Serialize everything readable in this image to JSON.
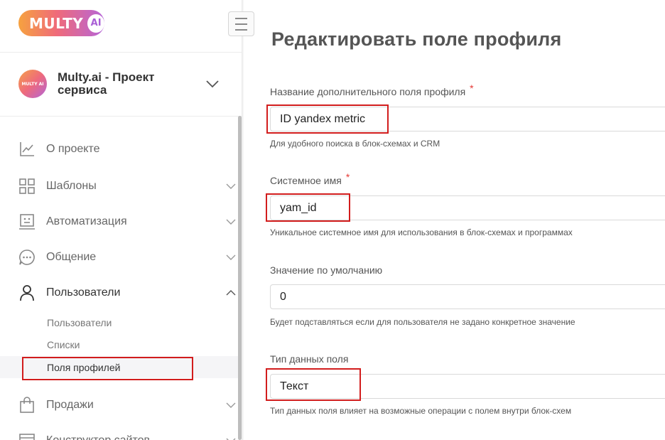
{
  "logo": {
    "text": "MULTY",
    "badge": "AI"
  },
  "project": {
    "avatar_text": "MULTY AI",
    "name": "Multy.ai - Проект сервиса"
  },
  "nav": {
    "about": "О проекте",
    "templates": "Шаблоны",
    "automation": "Автоматизация",
    "chat": "Общение",
    "users": "Пользователи",
    "users_sub": [
      "Пользователи",
      "Списки",
      "Поля профилей"
    ],
    "sales": "Продажи",
    "site_builder": "Конструктор сайтов"
  },
  "main": {
    "title": "Редактировать поле профиля",
    "fields": [
      {
        "label": "Название дополнительного поля профиля",
        "required": "*",
        "value": "ID yandex metric",
        "hint": "Для удобного поиска в блок-схемах и CRM"
      },
      {
        "label": "Системное имя",
        "required": "*",
        "value": "yam_id",
        "hint": "Уникальное системное имя для использования в блок-схемах и программах"
      },
      {
        "label": "Значение по умолчанию",
        "value": "0",
        "hint": "Будет подставляться если для пользователя не задано конкретное значение"
      },
      {
        "label": "Тип данных поля",
        "value": "Текст",
        "hint": "Тип данных поля влияет на возможные операции с полем внутри блок-схем"
      }
    ]
  },
  "colors": {
    "annotation": "#d21d1d",
    "required": "#e53935",
    "brand_start": "#f6a23f",
    "brand_end": "#b565d9"
  }
}
